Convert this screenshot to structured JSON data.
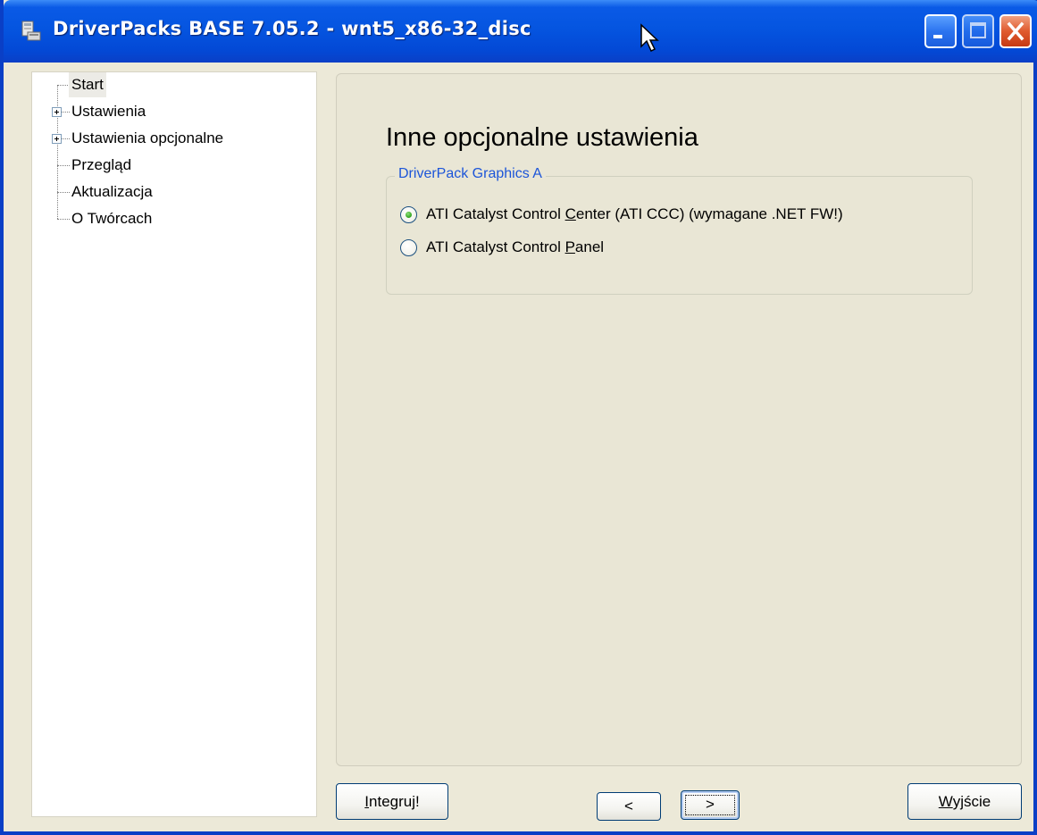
{
  "window": {
    "title": "DriverPacks BASE 7.05.2 -  wnt5_x86-32_disc",
    "controls": [
      "minimize-icon",
      "maximize-icon",
      "close-icon"
    ]
  },
  "tree": {
    "items": [
      {
        "label": "Start",
        "expandable": false,
        "selected": true
      },
      {
        "label": "Ustawienia",
        "expandable": true
      },
      {
        "label": "Ustawienia opcjonalne",
        "expandable": true
      },
      {
        "label": "Przegląd",
        "expandable": false
      },
      {
        "label": "Aktualizacja",
        "expandable": false
      },
      {
        "label": "O Twórcach",
        "expandable": false
      }
    ]
  },
  "main": {
    "title": "Inne opcjonalne ustawienia",
    "group": {
      "legend": "DriverPack Graphics A",
      "options": [
        {
          "pre": "ATI Catalyst Control ",
          "accel": "C",
          "post": "enter (ATI CCC) (wymagane .NET FW!)",
          "checked": true
        },
        {
          "pre": "ATI Catalyst Control ",
          "accel": "P",
          "post": "anel",
          "checked": false
        }
      ]
    }
  },
  "buttons": {
    "integrate": {
      "accel": "I",
      "rest": "ntegruj!"
    },
    "prev": "<",
    "next": ">",
    "exit": {
      "accel": "W",
      "rest": "yjście"
    }
  },
  "colors": {
    "titlebar": "#0555e0",
    "accent_legend": "#1c55d9",
    "radio_checked": "#2fa21c"
  }
}
